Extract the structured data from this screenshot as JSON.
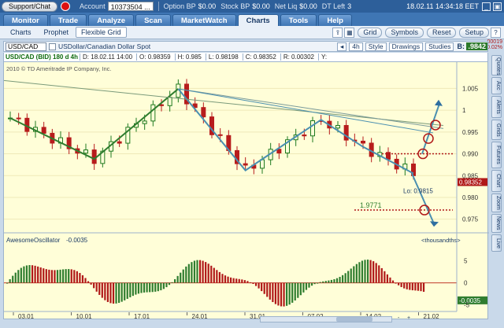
{
  "topbar": {
    "support_label": "Support/Chat",
    "account_label": "Account",
    "account_value": "10373504 ...",
    "option_bp_label": "Option BP",
    "option_bp_value": "$0.00",
    "stock_bp_label": "Stock BP",
    "stock_bp_value": "$0.00",
    "net_liq_label": "Net Liq",
    "net_liq_value": "$0.00",
    "dt_left_label": "DT Left",
    "dt_left_value": "3",
    "datetime": "18.02.11 14:34:18 EET"
  },
  "nav": {
    "tabs": [
      "Monitor",
      "Trade",
      "Analyze",
      "Scan",
      "MarketWatch",
      "Charts",
      "Tools",
      "Help"
    ],
    "active": "Charts"
  },
  "subnav": {
    "tabs": [
      "Charts",
      "Prophet",
      "Flexible Grid"
    ],
    "active": "Flexible Grid",
    "buttons": [
      "Grid",
      "Symbols",
      "Reset",
      "Setup"
    ]
  },
  "chartbar": {
    "symbol": "USD/CAD",
    "description": "USDollar/Canadian Dollar Spot",
    "period": "4h",
    "style_label": "Style",
    "drawings_label": "Drawings",
    "studies_label": "Studies",
    "bid_label": "B:",
    "bid_value": ".9842",
    "change_value": "-.00019",
    "change_pct": "-0.02%"
  },
  "infobar": {
    "symbol": "USD/CAD (BID) 180 d 4h",
    "date": "D: 18.02.11 14:00",
    "open": "O: 0.98359",
    "high": "H: 0.985",
    "low": "L: 0.98198",
    "close": "C: 0.98352",
    "range": "R: 0.00302",
    "y": "Y:"
  },
  "chart_text": {
    "copyright": "2010 © TD Ameritrade IP Company, Inc.",
    "low_label": "Lo: 0.9815",
    "price_label": "1.9771",
    "current_price": "0.98352",
    "oscillator_label": "AwesomeOscillator",
    "oscillator_value": "-0.0035",
    "oscillator_price": "-0.0035",
    "units_label": "<thousandths>"
  },
  "chart_data": [
    {
      "type": "candlestick",
      "title": "USD/CAD (BID) 180 d 4h",
      "x_ticks": [
        "03.01",
        "10.01",
        "17.01",
        "24.01",
        "31.01",
        "07.02",
        "14.02",
        "21.02"
      ],
      "y_ticks": [
        1.005,
        1,
        0.995,
        0.99,
        0.985,
        0.98,
        0.975
      ],
      "ylim": [
        0.9735,
        1.0085
      ],
      "pivot_lines": [
        {
          "name": "descending-wedge",
          "points": [
            [
              0,
              0.9982
            ],
            [
              10,
              0.9888
            ],
            [
              20,
              1.0049
            ],
            [
              28,
              0.9862
            ],
            [
              37,
              0.9978
            ],
            [
              42,
              0.9916
            ],
            [
              48,
              0.9855
            ]
          ]
        }
      ],
      "levels": [
        0.99,
        0.9771
      ]
    },
    {
      "type": "bar",
      "title": "AwesomeOscillator",
      "y_ticks": [
        5,
        0,
        -5
      ],
      "ylim": [
        -6,
        8
      ]
    }
  ],
  "vstrip": [
    "Quotes",
    "Acc",
    "Alerts",
    "Grids",
    "Futures",
    "Chart",
    "Zoom",
    "News",
    "Live"
  ],
  "bottom": {
    "zoom_out": "-",
    "zoom_in": "+"
  }
}
